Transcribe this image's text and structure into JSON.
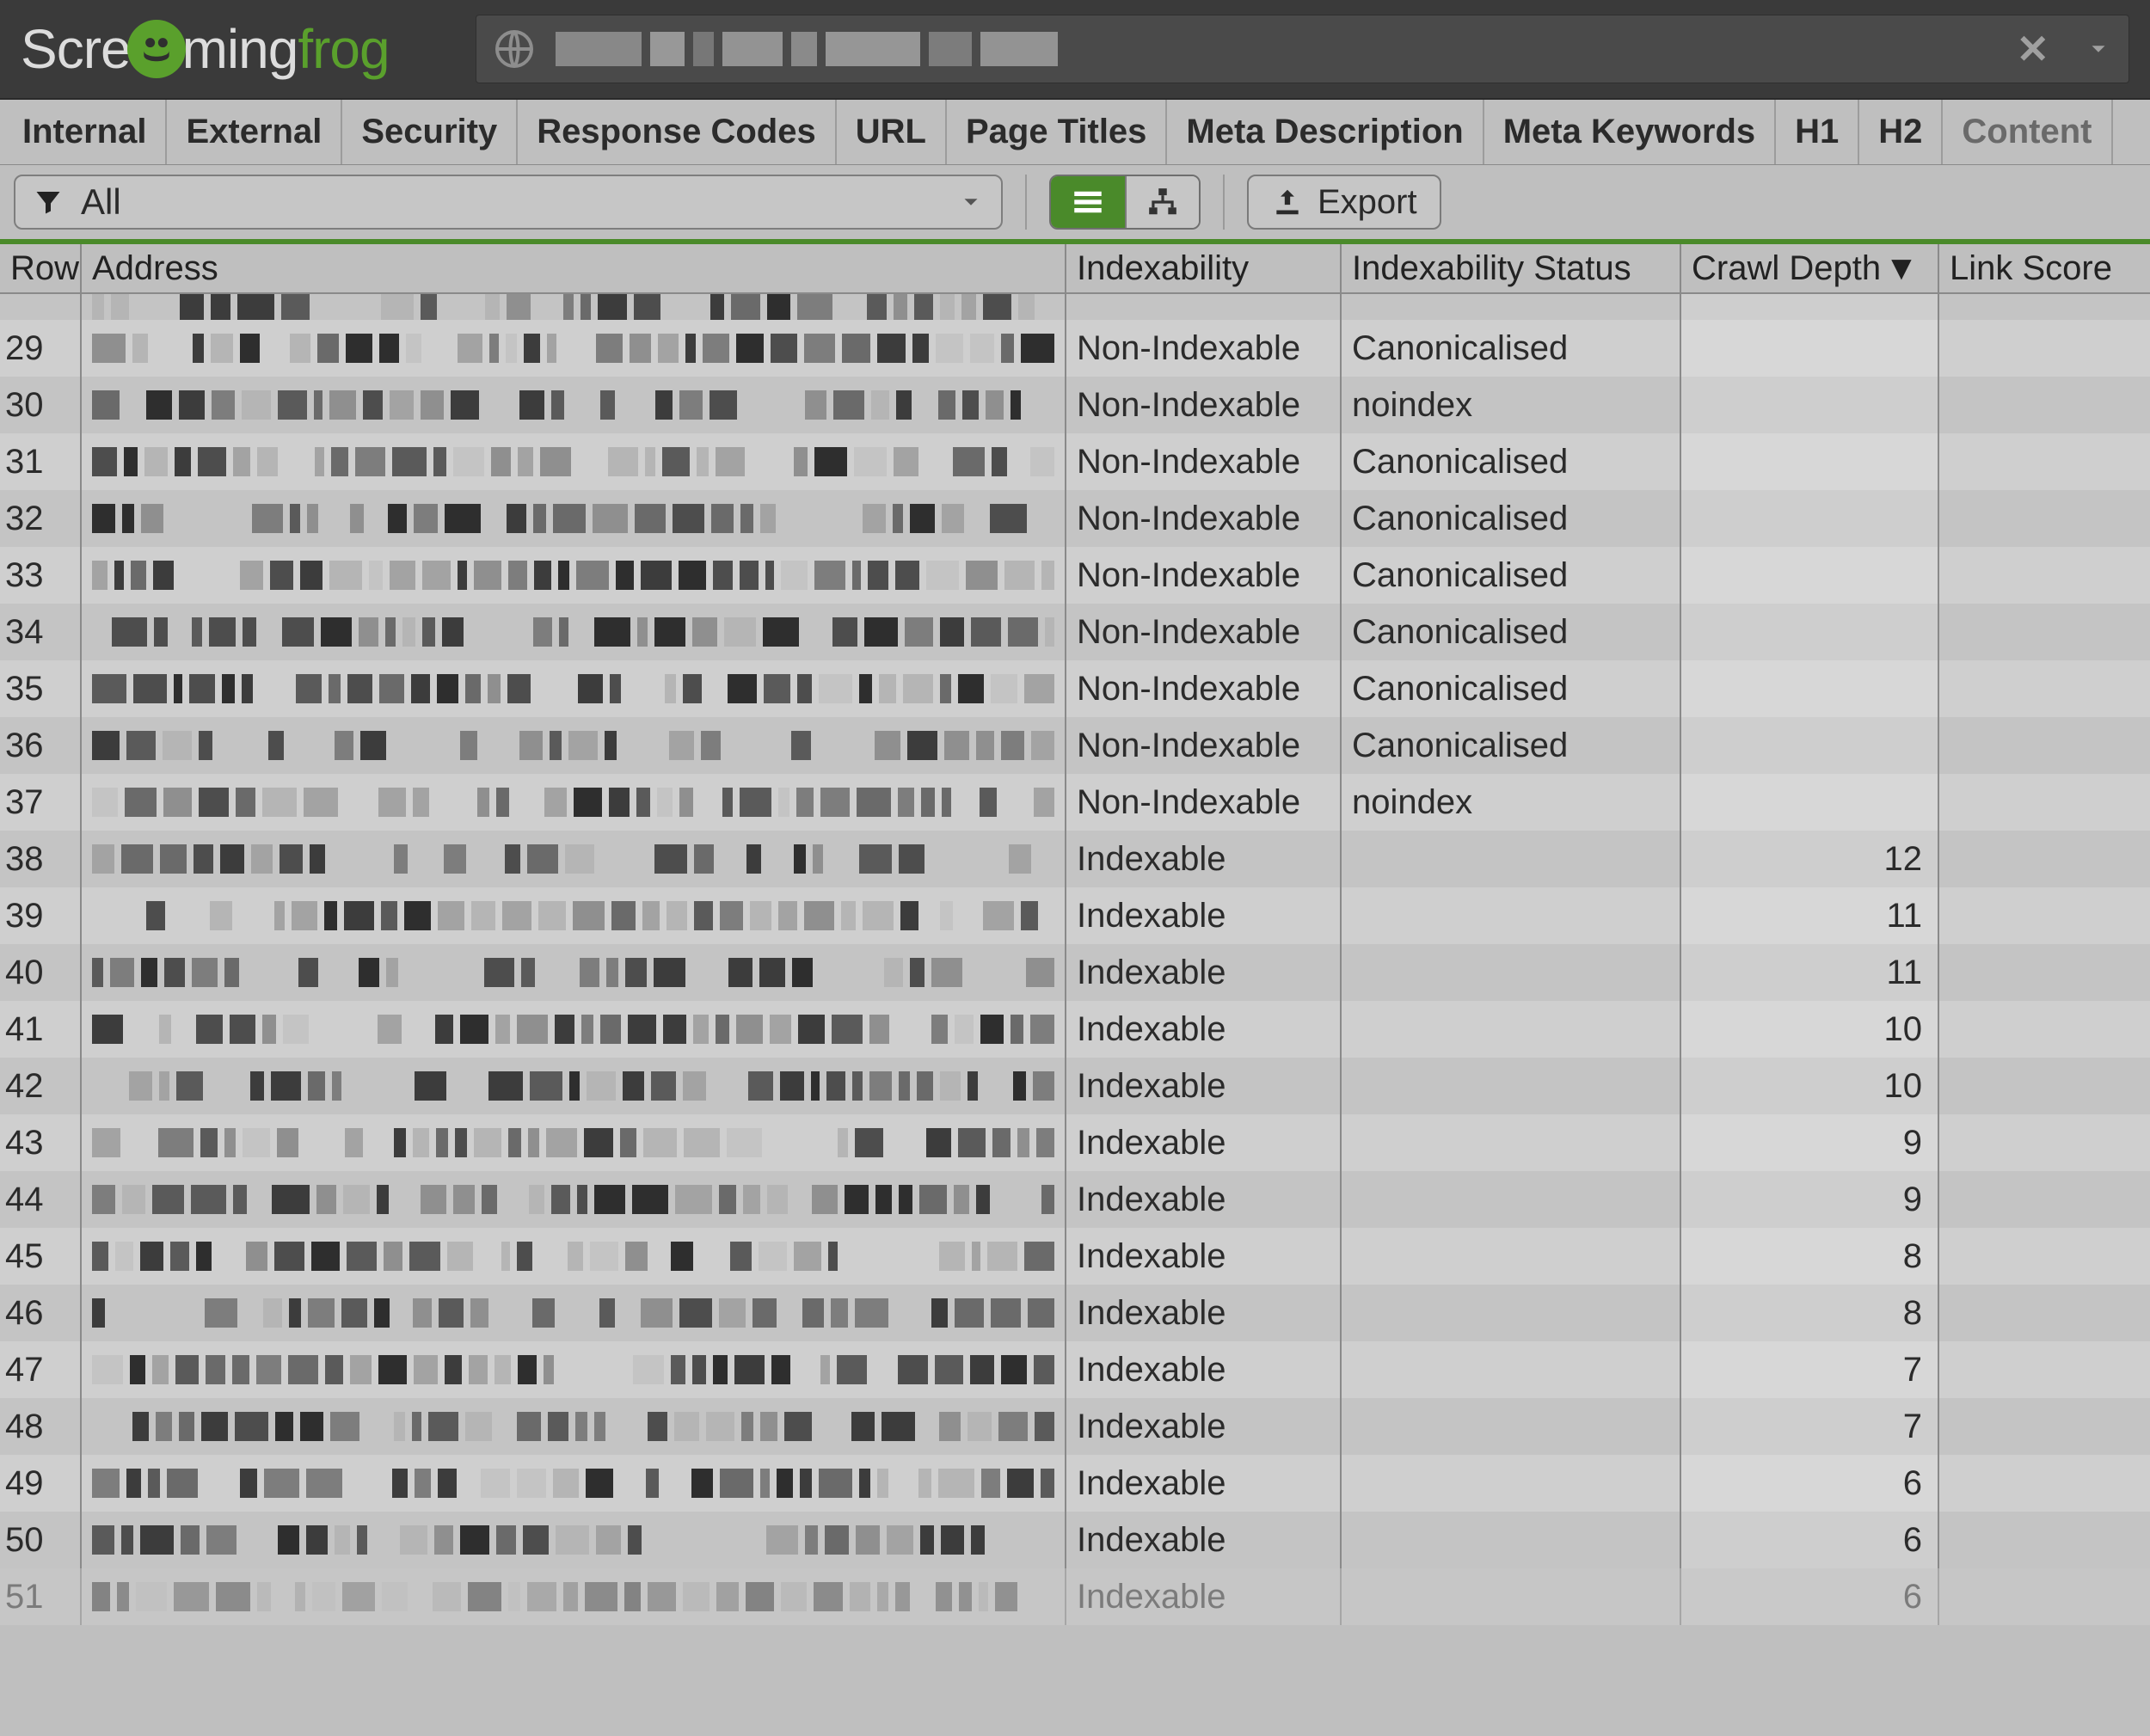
{
  "app": {
    "brand_scre": "Scre",
    "brand_ming": "ming",
    "brand_frog": "frog"
  },
  "tabs": [
    "Internal",
    "External",
    "Security",
    "Response Codes",
    "URL",
    "Page Titles",
    "Meta Description",
    "Meta Keywords",
    "H1",
    "H2",
    "Content"
  ],
  "filter": {
    "label": "All"
  },
  "export": {
    "label": "Export"
  },
  "columns": {
    "row": "Row",
    "address": "Address",
    "indexability": "Indexability",
    "indexability_status": "Indexability Status",
    "crawl_depth": "Crawl Depth",
    "link_score": "Link Score"
  },
  "sort": {
    "column": "crawl_depth",
    "direction": "desc"
  },
  "rows": [
    {
      "row": 29,
      "indexability": "Non-Indexable",
      "status": "Canonicalised",
      "depth": ""
    },
    {
      "row": 30,
      "indexability": "Non-Indexable",
      "status": "noindex",
      "depth": ""
    },
    {
      "row": 31,
      "indexability": "Non-Indexable",
      "status": "Canonicalised",
      "depth": ""
    },
    {
      "row": 32,
      "indexability": "Non-Indexable",
      "status": "Canonicalised",
      "depth": ""
    },
    {
      "row": 33,
      "indexability": "Non-Indexable",
      "status": "Canonicalised",
      "depth": ""
    },
    {
      "row": 34,
      "indexability": "Non-Indexable",
      "status": "Canonicalised",
      "depth": ""
    },
    {
      "row": 35,
      "indexability": "Non-Indexable",
      "status": "Canonicalised",
      "depth": ""
    },
    {
      "row": 36,
      "indexability": "Non-Indexable",
      "status": "Canonicalised",
      "depth": ""
    },
    {
      "row": 37,
      "indexability": "Non-Indexable",
      "status": "noindex",
      "depth": ""
    },
    {
      "row": 38,
      "indexability": "Indexable",
      "status": "",
      "depth": "12"
    },
    {
      "row": 39,
      "indexability": "Indexable",
      "status": "",
      "depth": "11"
    },
    {
      "row": 40,
      "indexability": "Indexable",
      "status": "",
      "depth": "11"
    },
    {
      "row": 41,
      "indexability": "Indexable",
      "status": "",
      "depth": "10"
    },
    {
      "row": 42,
      "indexability": "Indexable",
      "status": "",
      "depth": "10"
    },
    {
      "row": 43,
      "indexability": "Indexable",
      "status": "",
      "depth": "9"
    },
    {
      "row": 44,
      "indexability": "Indexable",
      "status": "",
      "depth": "9"
    },
    {
      "row": 45,
      "indexability": "Indexable",
      "status": "",
      "depth": "8"
    },
    {
      "row": 46,
      "indexability": "Indexable",
      "status": "",
      "depth": "8"
    },
    {
      "row": 47,
      "indexability": "Indexable",
      "status": "",
      "depth": "7"
    },
    {
      "row": 48,
      "indexability": "Indexable",
      "status": "",
      "depth": "7"
    },
    {
      "row": 49,
      "indexability": "Indexable",
      "status": "",
      "depth": "6"
    },
    {
      "row": 50,
      "indexability": "Indexable",
      "status": "",
      "depth": "6"
    },
    {
      "row": 51,
      "indexability": "Indexable",
      "status": "",
      "depth": "6"
    }
  ]
}
